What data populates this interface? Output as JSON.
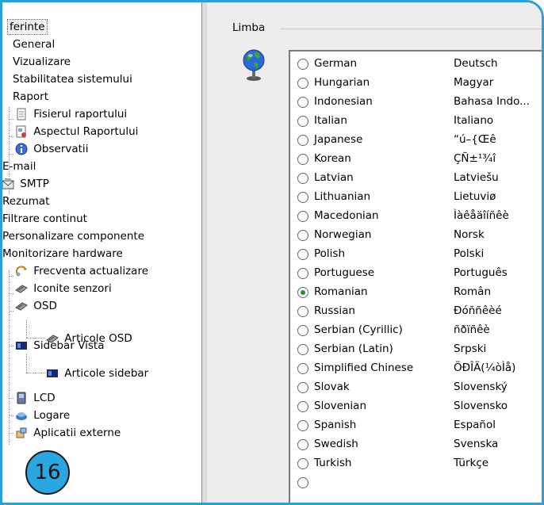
{
  "tree": {
    "items": [
      {
        "label": "ferinte",
        "icon": "none"
      },
      {
        "label": "General",
        "icon": "none"
      },
      {
        "label": "Vizualizare",
        "icon": "none"
      },
      {
        "label": "Stabilitatea sistemului",
        "icon": "none"
      },
      {
        "label": "Raport",
        "icon": "none"
      },
      {
        "label": "Fisierul raportului",
        "icon": "document-icon"
      },
      {
        "label": "Aspectul Raportului",
        "icon": "layout-icon"
      },
      {
        "label": "Observatii",
        "icon": "info-icon"
      },
      {
        "label": "E-mail",
        "icon": "none"
      },
      {
        "label": "SMTP",
        "icon": "mail-server-icon"
      },
      {
        "label": "Rezumat",
        "icon": "none"
      },
      {
        "label": "Filtrare continut",
        "icon": "none"
      },
      {
        "label": "Personalizare componente",
        "icon": "none"
      },
      {
        "label": "Monitorizare hardware",
        "icon": "none"
      },
      {
        "label": "Frecventa actualizare",
        "icon": "refresh-icon"
      },
      {
        "label": "Iconite senzori",
        "icon": "sensor-icon"
      },
      {
        "label": "OSD",
        "icon": "sensor-icon"
      },
      {
        "label": "Articole OSD",
        "icon": "sensor-icon"
      },
      {
        "label": "Sidebar Vista",
        "icon": "sidebar-icon"
      },
      {
        "label": "Articole sidebar",
        "icon": "sidebar-icon"
      },
      {
        "label": "LCD",
        "icon": "lcd-icon"
      },
      {
        "label": "Logare",
        "icon": "log-icon"
      },
      {
        "label": "Aplicatii externe",
        "icon": "apps-icon"
      }
    ]
  },
  "panel": {
    "group_label": "Limba",
    "icon": "globe-icon",
    "languages": [
      {
        "name": "German",
        "native": "Deutsch",
        "selected": false
      },
      {
        "name": "Hungarian",
        "native": "Magyar",
        "selected": false
      },
      {
        "name": "Indonesian",
        "native": "Bahasa Indo...",
        "selected": false
      },
      {
        "name": "Italian",
        "native": "Italiano",
        "selected": false
      },
      {
        "name": "Japanese",
        "native": "“ú–{Œê",
        "selected": false
      },
      {
        "name": "Korean",
        "native": "ÇÑ±¹¾î",
        "selected": false
      },
      {
        "name": "Latvian",
        "native": "Latviešu",
        "selected": false
      },
      {
        "name": "Lithuanian",
        "native": "Lietuviø",
        "selected": false
      },
      {
        "name": "Macedonian",
        "native": "Ìàêåäîíñêè",
        "selected": false
      },
      {
        "name": "Norwegian",
        "native": "Norsk",
        "selected": false
      },
      {
        "name": "Polish",
        "native": "Polski",
        "selected": false
      },
      {
        "name": "Portuguese",
        "native": "Português",
        "selected": false
      },
      {
        "name": "Romanian",
        "native": "Român",
        "selected": true
      },
      {
        "name": "Russian",
        "native": "Ðóññêèé",
        "selected": false
      },
      {
        "name": "Serbian (Cyrillic)",
        "native": "ñðïñêè",
        "selected": false
      },
      {
        "name": "Serbian (Latin)",
        "native": "Srpski",
        "selected": false
      },
      {
        "name": "Simplified Chinese",
        "native": "ÖÐÎÄ(¼òÌå)",
        "selected": false
      },
      {
        "name": "Slovak",
        "native": "Slovenský",
        "selected": false
      },
      {
        "name": "Slovenian",
        "native": "Slovensko",
        "selected": false
      },
      {
        "name": "Spanish",
        "native": "Español",
        "selected": false
      },
      {
        "name": "Swedish",
        "native": "Svenska",
        "selected": false
      },
      {
        "name": "Turkish",
        "native": "Türkçe",
        "selected": false
      }
    ]
  },
  "badge": {
    "number": "16",
    "color": "#2aa6e0"
  },
  "colors": {
    "frame": "#2b9fd8",
    "panel_bg": "#ececec",
    "radio_dot": "#2a8a2a"
  }
}
